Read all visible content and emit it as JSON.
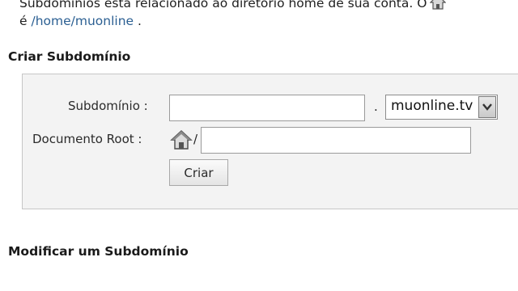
{
  "intro": {
    "line1": "Subdomínios está relacionado ao diretório home de sua conta. O",
    "line2_prefix": "é ",
    "home_path": "/home/muonline",
    "line2_suffix": " ."
  },
  "create_section": {
    "title": "Criar Subdomínio",
    "subdomain_label": "Subdomínio :",
    "subdomain_value": "",
    "separator": ".",
    "domain_selected": "muonline.tv",
    "document_root_label": "Documento Root :",
    "root_prefix": "/",
    "document_root_value": "",
    "create_button": "Criar"
  },
  "modify_section": {
    "title": "Modificar um Subdomínio"
  },
  "icons": {
    "home": "home-icon",
    "dropdown": "chevron-down-icon"
  },
  "colors": {
    "link": "#2b5f92",
    "form_background": "#f3f3f3",
    "form_border": "#c6c6c6"
  }
}
